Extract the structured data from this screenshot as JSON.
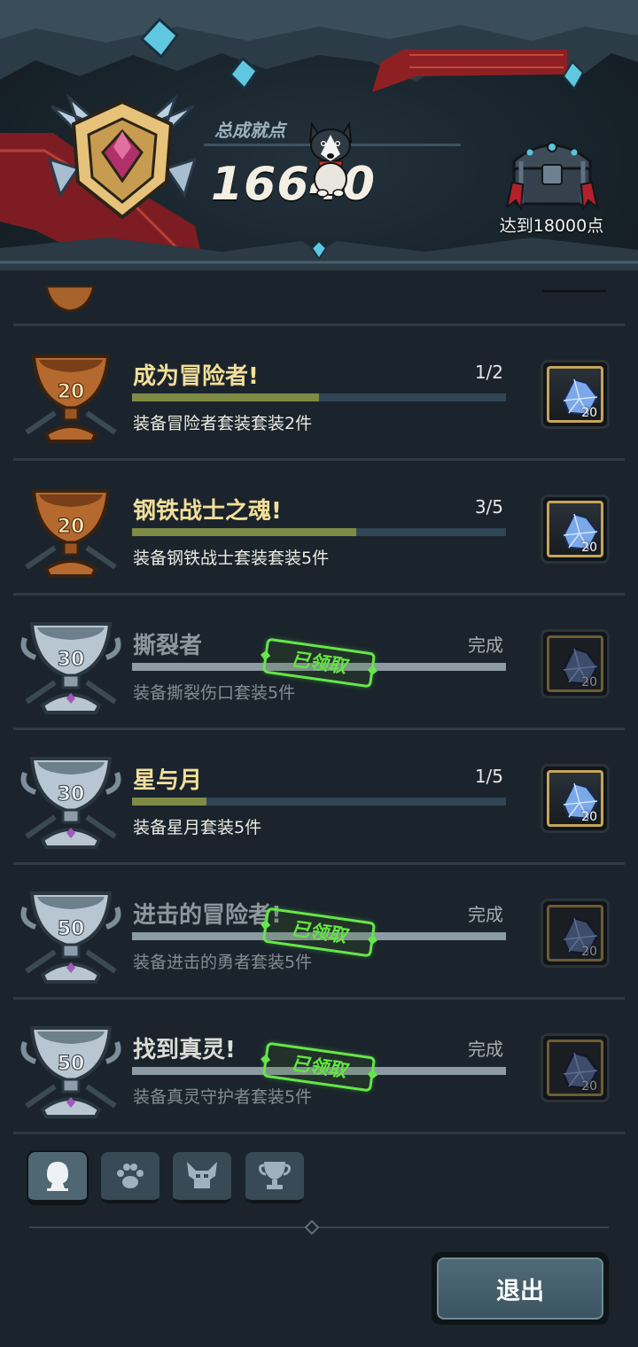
{
  "header": {
    "total_label": "总成就点",
    "total_value": "16640",
    "next_goal_label": "达到18000点"
  },
  "achievements": [
    {
      "tier": "bronze",
      "points": "20",
      "title": "成为冒险者!",
      "count": "1/2",
      "progress": 0.5,
      "desc": "装备冒险者套装套装2件",
      "done": false,
      "reward_qty": "20",
      "reward_icon": "crystal-icon"
    },
    {
      "tier": "bronze",
      "points": "20",
      "title": "钢铁战士之魂!",
      "count": "3/5",
      "progress": 0.6,
      "desc": "装备钢铁战士套装套装5件",
      "done": false,
      "reward_qty": "20",
      "reward_icon": "crystal-icon"
    },
    {
      "tier": "silver",
      "points": "30",
      "title": "撕裂者",
      "count": "完成",
      "progress": 1,
      "desc": "装备撕裂伤口套装5件",
      "done": true,
      "stamp": "已领取",
      "reward_qty": "20",
      "reward_icon": "crystal-icon"
    },
    {
      "tier": "silver",
      "points": "30",
      "title": "星与月",
      "count": "1/5",
      "progress": 0.2,
      "desc": "装备星月套装5件",
      "done": false,
      "reward_qty": "20",
      "reward_icon": "crystal-icon"
    },
    {
      "tier": "silver",
      "points": "50",
      "title": "进击的冒险者!",
      "count": "完成",
      "progress": 1,
      "desc": "装备进击的勇者套装5件",
      "done": true,
      "stamp": "已领取",
      "reward_qty": "20",
      "reward_icon": "crystal-icon"
    },
    {
      "tier": "silver",
      "points": "50",
      "title": "找到真灵!",
      "count": "完成",
      "progress": 1,
      "desc": "装备真灵守护者套装5件",
      "done": true,
      "stamp": "已领取",
      "reward_qty": "20",
      "reward_icon": "crystal-icon"
    }
  ],
  "tabs": [
    {
      "icon": "hero-head-icon",
      "active": true
    },
    {
      "icon": "paw-icon",
      "active": false
    },
    {
      "icon": "monster-icon",
      "active": false
    },
    {
      "icon": "trophy-icon",
      "active": false
    }
  ],
  "exit_label": "退出",
  "colors": {
    "title_gold": "#f3df9a",
    "stamp_green": "#62e63f",
    "bar_fill": "#7f8b45",
    "reward_border": "#c7a45a"
  }
}
